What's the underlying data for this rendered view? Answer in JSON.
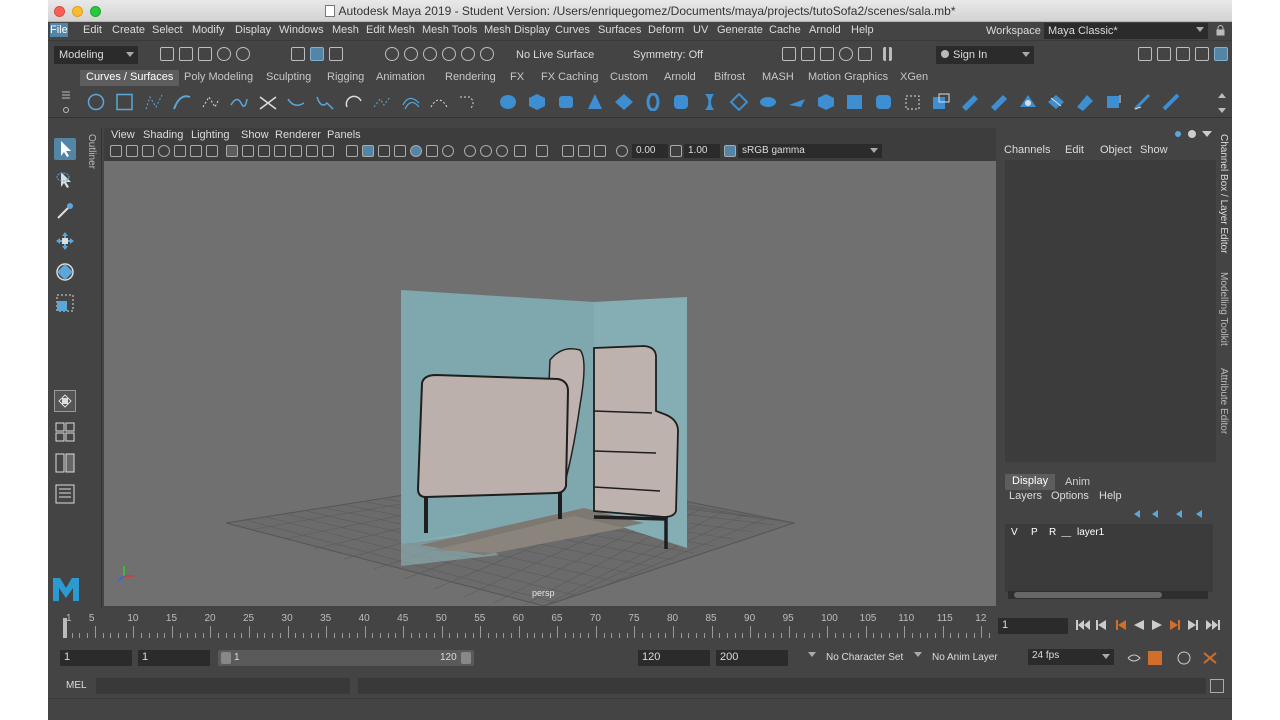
{
  "window": {
    "title": "Autodesk Maya 2019 - Student Version: /Users/enriquegomez/Documents/maya/projects/tutoSofa2/scenes/sala.mb*"
  },
  "menubar": {
    "items": [
      "File",
      "Edit",
      "Create",
      "Select",
      "Modify",
      "Display",
      "Windows",
      "Mesh",
      "Edit Mesh",
      "Mesh Tools",
      "Mesh Display",
      "Curves",
      "Surfaces",
      "Deform",
      "UV",
      "Generate",
      "Cache",
      "Arnold",
      "Help"
    ],
    "workspace_label": "Workspace :",
    "workspace_value": "Maya Classic*"
  },
  "status": {
    "mode": "Modeling",
    "live_surface": "No Live Surface",
    "symmetry": "Symmetry: Off",
    "sign_in": "Sign In"
  },
  "shelf_tabs": [
    "Curves / Surfaces",
    "Poly Modeling",
    "Sculpting",
    "Rigging",
    "Animation",
    "Rendering",
    "FX",
    "FX Caching",
    "Custom",
    "Arnold",
    "Bifrost",
    "MASH",
    "Motion Graphics",
    "XGen"
  ],
  "outliner_label": "Outliner",
  "viewport": {
    "menu": [
      "View",
      "Shading",
      "Lighting",
      "Show",
      "Renderer",
      "Panels"
    ],
    "exposure": "0.00",
    "gamma": "1.00",
    "color_space": "sRGB gamma",
    "camera": "persp"
  },
  "channel_box": {
    "menu": [
      "Channels",
      "Edit",
      "Object",
      "Show"
    ]
  },
  "layer_editor": {
    "tabs": [
      "Display",
      "Anim"
    ],
    "menu": [
      "Layers",
      "Options",
      "Help"
    ],
    "layer": {
      "v": "V",
      "p": "P",
      "r": "R",
      "name": "layer1"
    }
  },
  "side_tabs": [
    "Channel Box / Layer Editor",
    "Modelling Toolkit",
    "Attribute Editor"
  ],
  "timeline": {
    "labels": [
      "1",
      "5",
      "10",
      "15",
      "20",
      "25",
      "30",
      "35",
      "40",
      "45",
      "50",
      "55",
      "60",
      "65",
      "70",
      "75",
      "80",
      "85",
      "90",
      "95",
      "100",
      "105",
      "110",
      "115",
      "12"
    ],
    "current_frame": "1"
  },
  "range": {
    "start": "1",
    "playback_start": "1",
    "slider_start": "1",
    "slider_end": "120",
    "playback_end": "120",
    "end": "200",
    "character_set": "No Character Set",
    "anim_layer": "No Anim Layer",
    "fps": "24 fps"
  },
  "command_line": {
    "label": "MEL"
  },
  "colors": {
    "accent": "#5285a6",
    "wall": "#7fa8ae",
    "sofa": "#bdb0ad",
    "background": "#707070"
  }
}
